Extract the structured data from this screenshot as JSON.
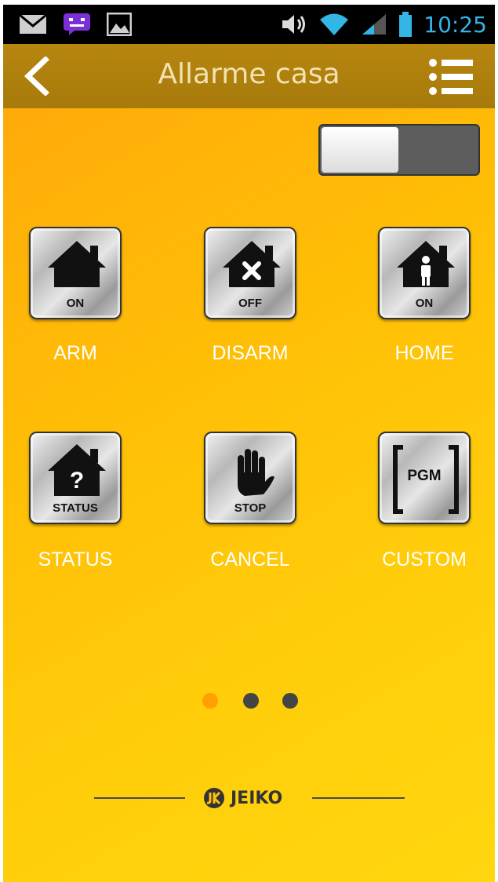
{
  "statusbar": {
    "time": "10:25",
    "left_icons": [
      "mail-icon",
      "chat-icon",
      "image-icon"
    ],
    "right_icons": [
      "volume-icon",
      "wifi-icon",
      "signal-icon",
      "battery-icon"
    ],
    "accent_color": "#33b5e5"
  },
  "appbar": {
    "title": "Allarme casa",
    "back_icon": "back-chevron-icon",
    "menu_icon": "list-menu-icon",
    "color": "#b07f0d"
  },
  "toggle": {
    "state": "off"
  },
  "controls": [
    {
      "caption": "ON",
      "label": "ARM",
      "icon": "house-icon"
    },
    {
      "caption": "OFF",
      "label": "DISARM",
      "icon": "house-x-icon"
    },
    {
      "caption": "ON",
      "label": "HOME",
      "icon": "house-person-icon"
    },
    {
      "caption": "STATUS",
      "label": "STATUS",
      "icon": "house-question-icon"
    },
    {
      "caption": "STOP",
      "label": "CANCEL",
      "icon": "hand-stop-icon"
    },
    {
      "caption": "PGM",
      "label": "CUSTOM",
      "icon": "pgm-bracket-icon"
    }
  ],
  "pager": {
    "count": 3,
    "active": 1,
    "active_color": "#ff9f00",
    "inactive_color": "#444444"
  },
  "brand": {
    "name": "JEIKO",
    "logo_letters": "JK"
  }
}
